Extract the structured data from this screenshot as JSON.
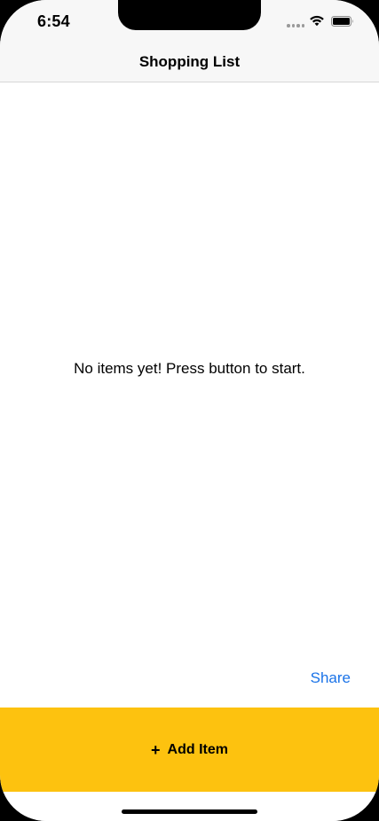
{
  "status_bar": {
    "time": "6:54",
    "signal_icon": "cellular-signal-icon",
    "wifi_icon": "wifi-icon",
    "battery_icon": "battery-icon"
  },
  "nav": {
    "title": "Shopping List"
  },
  "content": {
    "empty_message": "No items yet! Press button to start.",
    "share_label": "Share"
  },
  "add_button": {
    "icon": "+",
    "label": "Add Item"
  },
  "colors": {
    "accent": "#fdc20f",
    "link": "#1a73e8",
    "bar_background": "#f7f7f7"
  }
}
